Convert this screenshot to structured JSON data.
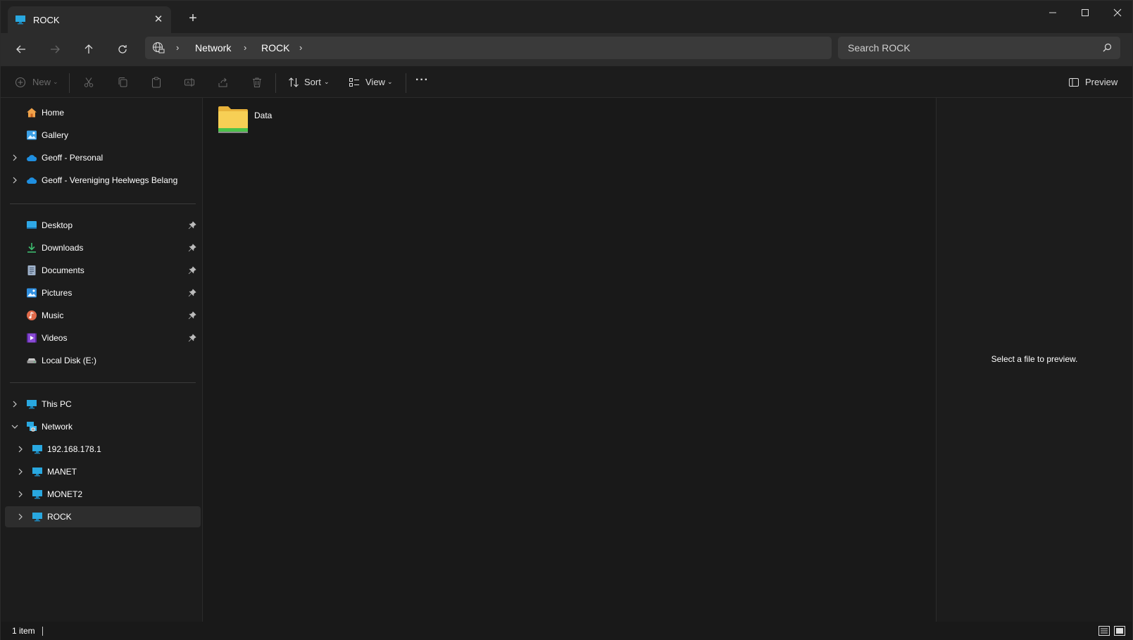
{
  "tab": {
    "title": "ROCK",
    "close": "✕",
    "new": "+"
  },
  "breadcrumb": [
    "Network",
    "ROCK"
  ],
  "search": {
    "placeholder": "Search ROCK"
  },
  "commands": {
    "new": "New",
    "sort": "Sort",
    "view": "View",
    "more": "···",
    "preview": "Preview"
  },
  "sidebar": {
    "quick": [
      {
        "label": "Home",
        "icon": "home-icon"
      },
      {
        "label": "Gallery",
        "icon": "gallery-icon"
      },
      {
        "label": "Geoff - Personal",
        "icon": "onedrive-icon",
        "expandable": true
      },
      {
        "label": "Geoff - Vereniging Heelwegs Belang",
        "icon": "onedrive-icon",
        "expandable": true
      }
    ],
    "pinned": [
      {
        "label": "Desktop",
        "icon": "desktop-icon",
        "pinned": true
      },
      {
        "label": "Downloads",
        "icon": "downloads-icon",
        "pinned": true
      },
      {
        "label": "Documents",
        "icon": "documents-icon",
        "pinned": true
      },
      {
        "label": "Pictures",
        "icon": "pictures-icon",
        "pinned": true
      },
      {
        "label": "Music",
        "icon": "music-icon",
        "pinned": true
      },
      {
        "label": "Videos",
        "icon": "videos-icon",
        "pinned": true
      },
      {
        "label": "Local Disk (E:)",
        "icon": "drive-icon",
        "pinned": false
      }
    ],
    "tree": [
      {
        "label": "This PC",
        "icon": "computer-icon",
        "expanded": false
      },
      {
        "label": "Network",
        "icon": "network-icon",
        "expanded": true
      },
      {
        "label": "192.168.178.1",
        "icon": "computer-icon",
        "expanded": false
      },
      {
        "label": "MANET",
        "icon": "computer-icon",
        "expanded": false
      },
      {
        "label": "MONET2",
        "icon": "computer-icon",
        "expanded": false
      },
      {
        "label": "ROCK",
        "icon": "computer-icon",
        "expanded": false,
        "selected": true
      }
    ]
  },
  "content": {
    "items": [
      {
        "name": "Data",
        "type": "folder"
      }
    ]
  },
  "preview": {
    "message": "Select a file to preview."
  },
  "status": {
    "count": "1 item"
  },
  "colors": {
    "window_bg": "#191919",
    "accent_blue": "#29a8e0",
    "folder_yellow": "#f4c84a",
    "folder_green": "#4cc24a"
  }
}
